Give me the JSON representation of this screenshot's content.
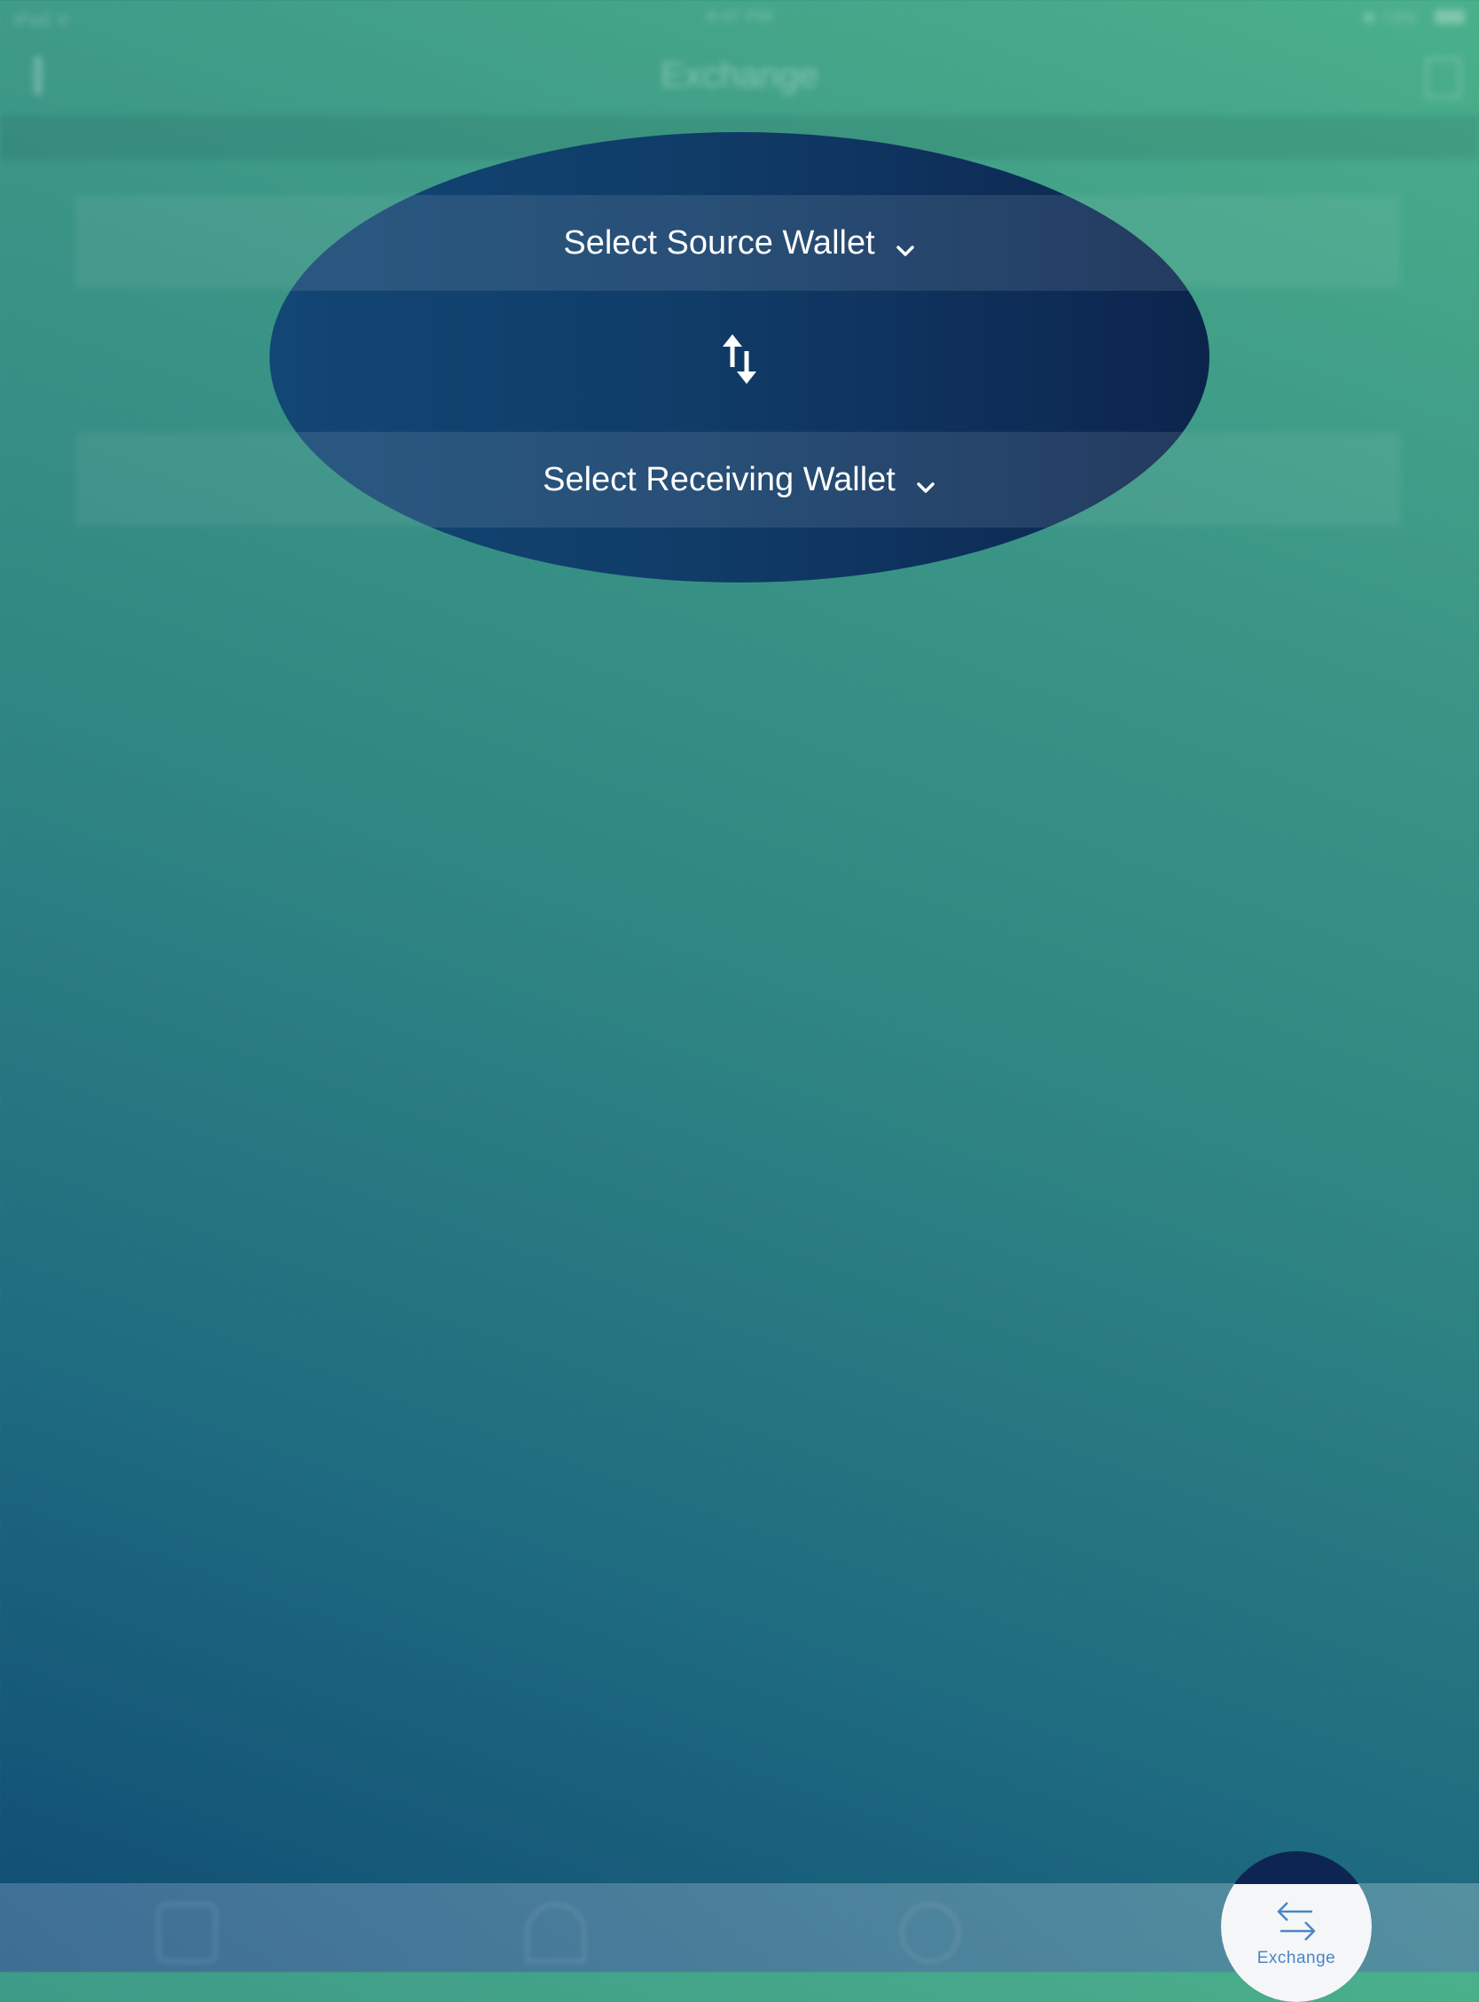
{
  "status_bar": {
    "left": "iPad ᯤ",
    "time": "8:47 PM",
    "right": "✱ 74%"
  },
  "header": {
    "title": "Exchange"
  },
  "exchange_form": {
    "source_wallet_label": "Select Source Wallet",
    "receiving_wallet_label": "Select Receiving Wallet"
  },
  "tab_bar": {
    "active_tab_label": "Exchange"
  },
  "colors": {
    "spotlight": "#0d2b55",
    "tab_active_text": "#4a86c5",
    "background_top": "#4ab08b",
    "background_bottom": "#0f4c73"
  },
  "icons": {
    "swap": "swap-vertical-icon",
    "dropdown": "chevron-down-icon",
    "exchange_tab": "exchange-arrows-icon"
  }
}
